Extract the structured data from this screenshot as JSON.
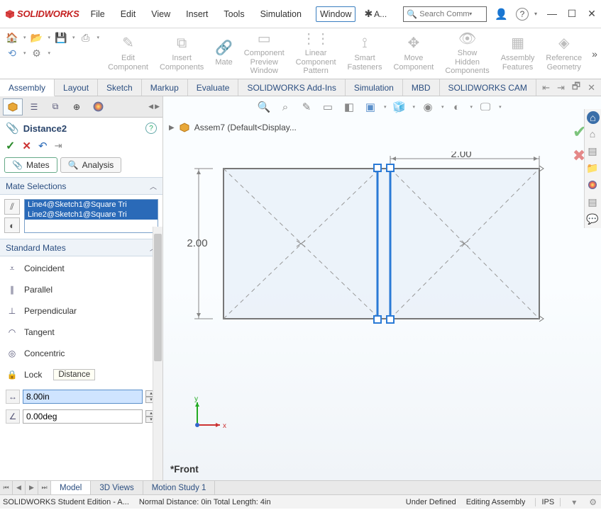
{
  "app": {
    "name": "SOLIDWORKS",
    "extra_menu": "A..."
  },
  "menu": {
    "items": [
      "File",
      "Edit",
      "View",
      "Insert",
      "Tools",
      "Simulation",
      "Window"
    ],
    "active": "Window"
  },
  "search": {
    "placeholder": "Search Comman"
  },
  "ribbon": {
    "groups": [
      {
        "label": "Edit\nComponent"
      },
      {
        "label": "Insert\nComponents"
      },
      {
        "label": "Mate"
      },
      {
        "label": "Component\nPreview\nWindow"
      },
      {
        "label": "Linear Component\nPattern"
      },
      {
        "label": "Smart\nFasteners"
      },
      {
        "label": "Move\nComponent"
      },
      {
        "label": "Show\nHidden\nComponents"
      },
      {
        "label": "Assembly\nFeatures"
      },
      {
        "label": "Reference\nGeometry"
      }
    ]
  },
  "tabs": {
    "items": [
      "Assembly",
      "Layout",
      "Sketch",
      "Markup",
      "Evaluate",
      "SOLIDWORKS Add-Ins",
      "Simulation",
      "MBD",
      "SOLIDWORKS CAM"
    ],
    "active": "Assembly"
  },
  "property": {
    "title": "Distance2",
    "subtabs": {
      "mates": "Mates",
      "analysis": "Analysis"
    },
    "sections": {
      "selections": "Mate Selections",
      "standard": "Standard Mates"
    },
    "selections": [
      "Line4@Sketch1@Square Tri",
      "Line2@Sketch1@Square Tri"
    ],
    "mates": {
      "coincident": "Coincident",
      "parallel": "Parallel",
      "perpendicular": "Perpendicular",
      "tangent": "Tangent",
      "concentric": "Concentric",
      "lock": "Lock",
      "lock_tooltip": "Distance"
    },
    "distance_value": "8.00in",
    "angle_value": "0.00deg"
  },
  "canvas": {
    "breadcrumb": "Assem7  (Default<Display...",
    "dimensions": {
      "top": "2.00",
      "left": "2.00"
    },
    "view_label": "*Front",
    "triad": {
      "x": "x",
      "y": "y"
    }
  },
  "bottom_tabs": {
    "items": [
      "Model",
      "3D Views",
      "Motion Study 1"
    ],
    "active": "Model"
  },
  "status": {
    "left": "SOLIDWORKS Student Edition - A...",
    "mid": "Normal Distance: 0in Total Length: 4in",
    "def": "Under Defined",
    "mode": "Editing Assembly",
    "units": "IPS"
  }
}
